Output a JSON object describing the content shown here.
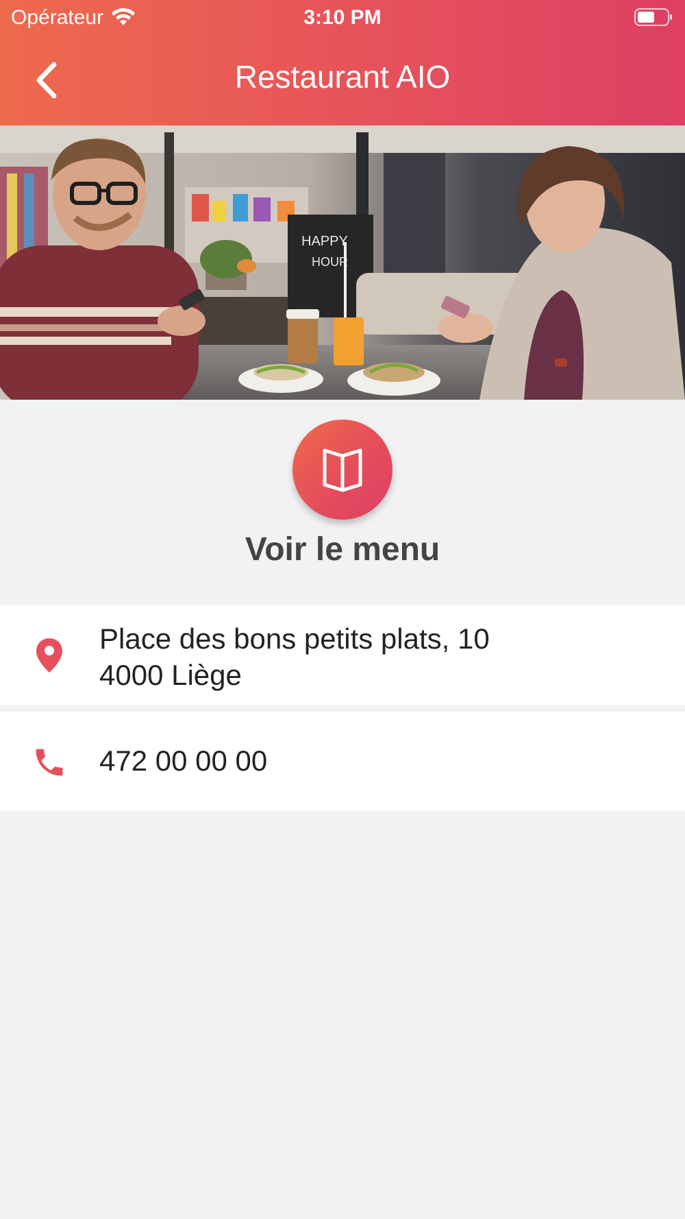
{
  "status_bar": {
    "carrier": "Opérateur",
    "time": "3:10 PM"
  },
  "header": {
    "title": "Restaurant AIO",
    "back_icon": "chevron-left-icon"
  },
  "hero_image": {
    "subject": "photo"
  },
  "menu": {
    "label": "Voir le menu",
    "icon": "book-icon"
  },
  "info": {
    "address_line1": "Place des bons petits plats, 10",
    "address_line2": "4000 Liège",
    "address_icon": "location-pin-icon",
    "phone": "472 00 00 00",
    "phone_icon": "phone-icon"
  },
  "colors": {
    "accent": "#e5505c",
    "gradient_start": "#ee6a4d",
    "gradient_end": "#de3f63",
    "background": "#f1f2f4"
  }
}
